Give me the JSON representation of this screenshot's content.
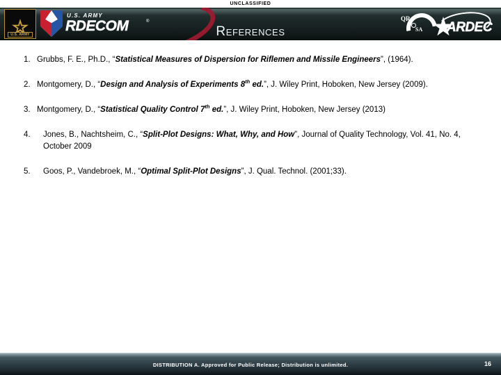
{
  "classification": {
    "top_marking": "UNCLASSIFIED"
  },
  "header": {
    "title": "References",
    "army_emblem": {
      "wordmark": "U.S. ARMY",
      "icon": "army-star-icon"
    },
    "rdecom": {
      "sub_text": "U.S. ARMY",
      "main_text": "RDECOM",
      "registered_mark": "®",
      "icon": "rdecom-shield-icon"
    },
    "qrsa": {
      "line1": "QR",
      "line2": "SA",
      "icon": "qrsa-logo-icon"
    },
    "ardec": {
      "text": "ARDEC",
      "icon": "ardec-star-icon"
    }
  },
  "references": [
    {
      "number": "1.",
      "indent": "narrow",
      "parts": [
        {
          "text": "Grubbs, F. E., Ph.D., “",
          "style": "normal"
        },
        {
          "text": "Statistical Measures of Dispersion for Riflemen and Missile Engineers",
          "style": "title"
        },
        {
          "text": "”, (1964).",
          "style": "normal"
        }
      ]
    },
    {
      "number": "2.",
      "indent": "narrow",
      "parts": [
        {
          "text": "Montgomery, D., “",
          "style": "normal"
        },
        {
          "text": "Design and Analysis of Experiments 8",
          "style": "title"
        },
        {
          "text": "th",
          "style": "title-sup"
        },
        {
          "text": " ed.",
          "style": "title"
        },
        {
          "text": "”, J. Wiley Print, Hoboken, New Jersey (2009).",
          "style": "normal"
        }
      ]
    },
    {
      "number": "3.",
      "indent": "narrow",
      "parts": [
        {
          "text": "Montgomery, D., “",
          "style": "normal"
        },
        {
          "text": "Statistical Quality Control 7",
          "style": "title"
        },
        {
          "text": "th",
          "style": "title-sup"
        },
        {
          "text": " ed.",
          "style": "title"
        },
        {
          "text": "”, J. Wiley Print, Hoboken, New Jersey (2013)",
          "style": "normal"
        }
      ]
    },
    {
      "number": "4.",
      "indent": "wide",
      "parts": [
        {
          "text": "Jones, B., Nachtsheim, C., “",
          "style": "normal"
        },
        {
          "text": "Split-Plot Designs: What, Why, and How",
          "style": "title"
        },
        {
          "text": "”, Journal of Quality Technology, Vol. 41, No. 4, October 2009",
          "style": "normal"
        }
      ]
    },
    {
      "number": "5.",
      "indent": "wide",
      "parts": [
        {
          "text": "Goos, P., Vandebroek, M., “",
          "style": "normal"
        },
        {
          "text": "Optimal Split-Plot Designs",
          "style": "title"
        },
        {
          "text": "”, J. Qual. Technol. (2001;33).",
          "style": "normal"
        }
      ]
    }
  ],
  "footer": {
    "distribution_statement": "DISTRIBUTION A. Approved for Public Release; Distribution is unlimited.",
    "page_number": "16"
  },
  "colors": {
    "header_dark": "#1b2626",
    "footer_slate": "#33444c",
    "army_gold": "#b9912f",
    "rdecom_red": "#9e1b2f",
    "shield_red": "#c8202f",
    "shield_blue": "#2555a4"
  }
}
